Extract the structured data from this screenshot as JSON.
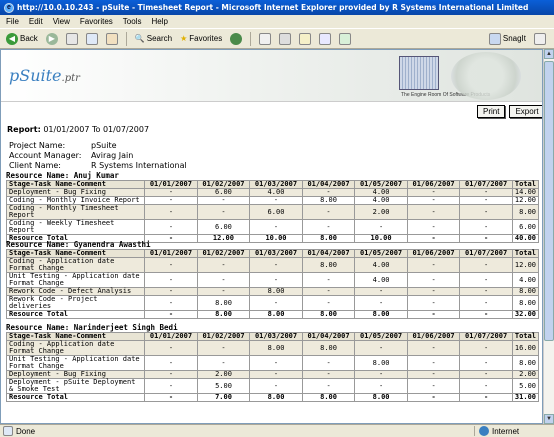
{
  "window": {
    "title": "http://10.0.10.243 - pSuite - Timesheet Report - Microsoft Internet Explorer provided by R Systems International Limited"
  },
  "menu": [
    "File",
    "Edit",
    "View",
    "Favorites",
    "Tools",
    "Help"
  ],
  "toolbar": {
    "back": "Back",
    "search": "Search",
    "favorites": "Favorites",
    "snagit": "SnagIt"
  },
  "banner": {
    "logo_main": "pSuite",
    "logo_suffix": ".ptr",
    "tagline": "The Engine Room Of Software Products"
  },
  "actions": {
    "print": "Print",
    "export": "Export"
  },
  "report": {
    "label": "Report:",
    "range": "01/01/2007 To 01/07/2007",
    "project_label": "Project Name:",
    "project": "pSuite",
    "manager_label": "Account Manager:",
    "manager": "Avirag Jain",
    "client_label": "Client Name:",
    "client": "R Systems International"
  },
  "columns": [
    "Stage-Task Name-Comment",
    "01/01/2007",
    "01/02/2007",
    "01/03/2007",
    "01/04/2007",
    "01/05/2007",
    "01/06/2007",
    "01/07/2007",
    "Total"
  ],
  "sections": [
    {
      "resource": "Resource Name: Anuj Kumar",
      "rows": [
        [
          "Deployment - Bug Fixing",
          "-",
          "6.00",
          "4.00",
          "-",
          "4.00",
          "-",
          "-",
          "14.00"
        ],
        [
          "Coding - Monthly Invoice Report",
          "-",
          "-",
          "-",
          "8.00",
          "4.00",
          "-",
          "-",
          "12.00"
        ],
        [
          "Coding - Monthly Timesheet Report",
          "-",
          "-",
          "6.00",
          "-",
          "2.00",
          "-",
          "-",
          "8.00"
        ],
        [
          "Coding - Weekly Timesheet Report",
          "-",
          "6.00",
          "-",
          "-",
          "-",
          "-",
          "-",
          "6.00"
        ]
      ],
      "total": [
        "Resource Total",
        "-",
        "12.00",
        "10.00",
        "8.00",
        "10.00",
        "-",
        "-",
        "40.00"
      ]
    },
    {
      "resource": "Resource Name: Gyanendra Awasthi",
      "rows": [
        [
          "Coding - Application date Format Change",
          "-",
          "-",
          "-",
          "8.00",
          "4.00",
          "-",
          "-",
          "12.00"
        ],
        [
          "Unit Testing - Application date Format Change",
          "-",
          "-",
          "-",
          "-",
          "4.00",
          "-",
          "-",
          "4.00"
        ],
        [
          "Rework Code - Defect Analysis",
          "-",
          "-",
          "8.00",
          "-",
          "-",
          "-",
          "-",
          "8.00"
        ],
        [
          "Rework Code - Project deliveries",
          "-",
          "8.00",
          "-",
          "-",
          "-",
          "-",
          "-",
          "8.00"
        ]
      ],
      "total": [
        "Resource Total",
        "-",
        "8.00",
        "8.00",
        "8.00",
        "8.00",
        "-",
        "-",
        "32.00"
      ]
    },
    {
      "resource": "Resource Name: Narinderjeet Singh Bedi",
      "rows": [
        [
          "Coding - Application date Format Change",
          "-",
          "-",
          "8.00",
          "8.00",
          "-",
          "-",
          "-",
          "16.00"
        ],
        [
          "Unit Testing - Application date Format Change",
          "-",
          "-",
          "-",
          "-",
          "8.00",
          "-",
          "-",
          "8.00"
        ],
        [
          "Deployment - Bug Fixing",
          "-",
          "2.00",
          "-",
          "-",
          "-",
          "-",
          "-",
          "2.00"
        ],
        [
          "Deployment - pSuite Deployment & Smoke Test",
          "-",
          "5.00",
          "-",
          "-",
          "-",
          "-",
          "-",
          "5.00"
        ]
      ],
      "total": [
        "Resource Total",
        "-",
        "7.00",
        "8.00",
        "8.00",
        "8.00",
        "-",
        "-",
        "31.00"
      ]
    }
  ],
  "status": {
    "left": "Done",
    "zone": "Internet"
  }
}
